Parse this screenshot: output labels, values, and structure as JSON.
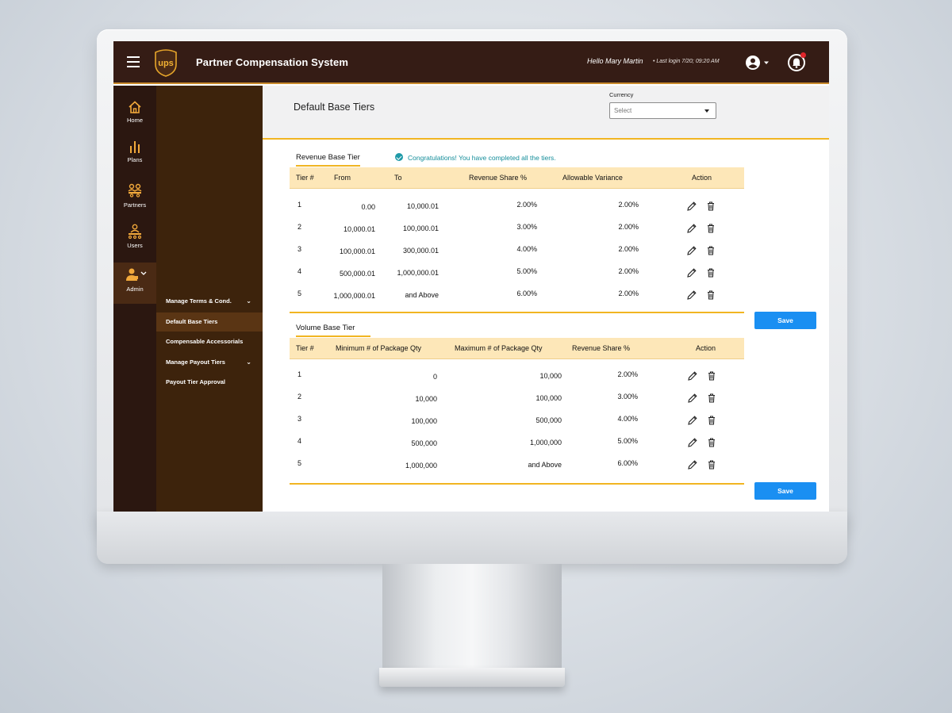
{
  "header": {
    "app_title": "Partner Compensation System",
    "greeting": "Hello Mary Martin",
    "last_login": "•  Last login 7/20; 09:20 AM",
    "logo_text": "ups"
  },
  "rail": {
    "items": [
      {
        "label": "Home",
        "icon": "home-icon"
      },
      {
        "label": "Plans",
        "icon": "bar-chart-icon"
      },
      {
        "label": "Partners",
        "icon": "partners-icon"
      },
      {
        "label": "Users",
        "icon": "users-icon"
      },
      {
        "label": "Admin",
        "icon": "admin-icon",
        "active": true
      }
    ]
  },
  "subnav": {
    "items": [
      {
        "label": "Manage Terms & Cond.",
        "chevron": true
      },
      {
        "label": "Default Base Tiers",
        "active": true
      },
      {
        "label": "Compensable Accessorials"
      },
      {
        "label": "Manage Payout Tiers",
        "chevron": true
      },
      {
        "label": "Payout Tier Approval"
      }
    ]
  },
  "page": {
    "title": "Default Base Tiers",
    "currency_label": "Currency",
    "currency_placeholder": "Select"
  },
  "revenue": {
    "title": "Revenue Base Tier",
    "success_message": "Congratulations! You have completed all the tiers.",
    "headers": [
      "Tier #",
      "From",
      "To",
      "Revenue Share %",
      "Allowable Variance",
      "Action"
    ],
    "rows": [
      [
        "1",
        "0.00",
        "10,000.01",
        "2.00%",
        "2.00%"
      ],
      [
        "2",
        "10,000.01",
        "100,000.01",
        "3.00%",
        "2.00%"
      ],
      [
        "3",
        "100,000.01",
        "300,000.01",
        "4.00%",
        "2.00%"
      ],
      [
        "4",
        "500,000.01",
        "1,000,000.01",
        "5.00%",
        "2.00%"
      ],
      [
        "5",
        "1,000,000.01",
        "and Above",
        "6.00%",
        "2.00%"
      ]
    ],
    "save_label": "Save"
  },
  "volume": {
    "title": "Volume Base Tier",
    "headers": [
      "Tier #",
      "Minimum # of Package Qty",
      "Maximum # of Package Qty",
      "Revenue Share %",
      "Action"
    ],
    "rows": [
      [
        "1",
        "0",
        "10,000",
        "2.00%"
      ],
      [
        "2",
        "10,000",
        "100,000",
        "3.00%"
      ],
      [
        "3",
        "100,000",
        "500,000",
        "4.00%"
      ],
      [
        "4",
        "500,000",
        "1,000,000",
        "5.00%"
      ],
      [
        "5",
        "1,000,000",
        "and Above",
        "6.00%"
      ]
    ],
    "save_label": "Save"
  },
  "colors": {
    "topbar": "#351c15",
    "rail": "#2b1710",
    "subnav": "#3d230c",
    "accent_gold": "#f1b522",
    "table_header": "#fde7b8",
    "success_teal": "#138d9a",
    "save_blue": "#1a8ff2",
    "notification_red": "#e0262b"
  }
}
